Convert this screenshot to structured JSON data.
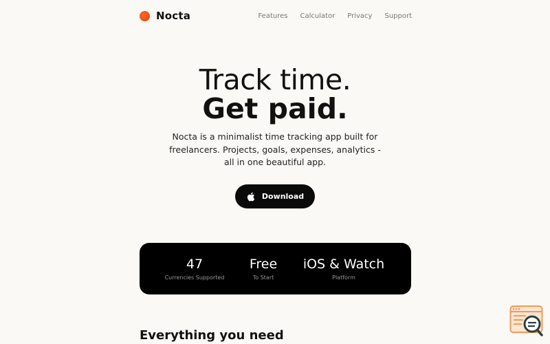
{
  "header": {
    "brand": "Nocta",
    "nav": [
      "Features",
      "Calculator",
      "Privacy",
      "Support"
    ]
  },
  "hero": {
    "title_line1": "Track time.",
    "title_line2": "Get paid.",
    "description": "Nocta is a minimalist time tracking app built for freelancers. Projects, goals, expenses, analytics - all in one beautiful app.",
    "download_label": "Download"
  },
  "stats": [
    {
      "value": "47",
      "label": "Currencies Supported"
    },
    {
      "value": "Free",
      "label": "To Start"
    },
    {
      "value": "iOS & Watch",
      "label": "Platform"
    }
  ],
  "section": {
    "title": "Everything you need"
  },
  "colors": {
    "background": "#fbf9f6",
    "accent": "#f04a12",
    "dark": "#0a0a0a",
    "widget": "#f0a060"
  },
  "icons": {
    "logo": "logo-dot-icon",
    "download": "apple-icon",
    "widget": "search-widget-icon"
  }
}
